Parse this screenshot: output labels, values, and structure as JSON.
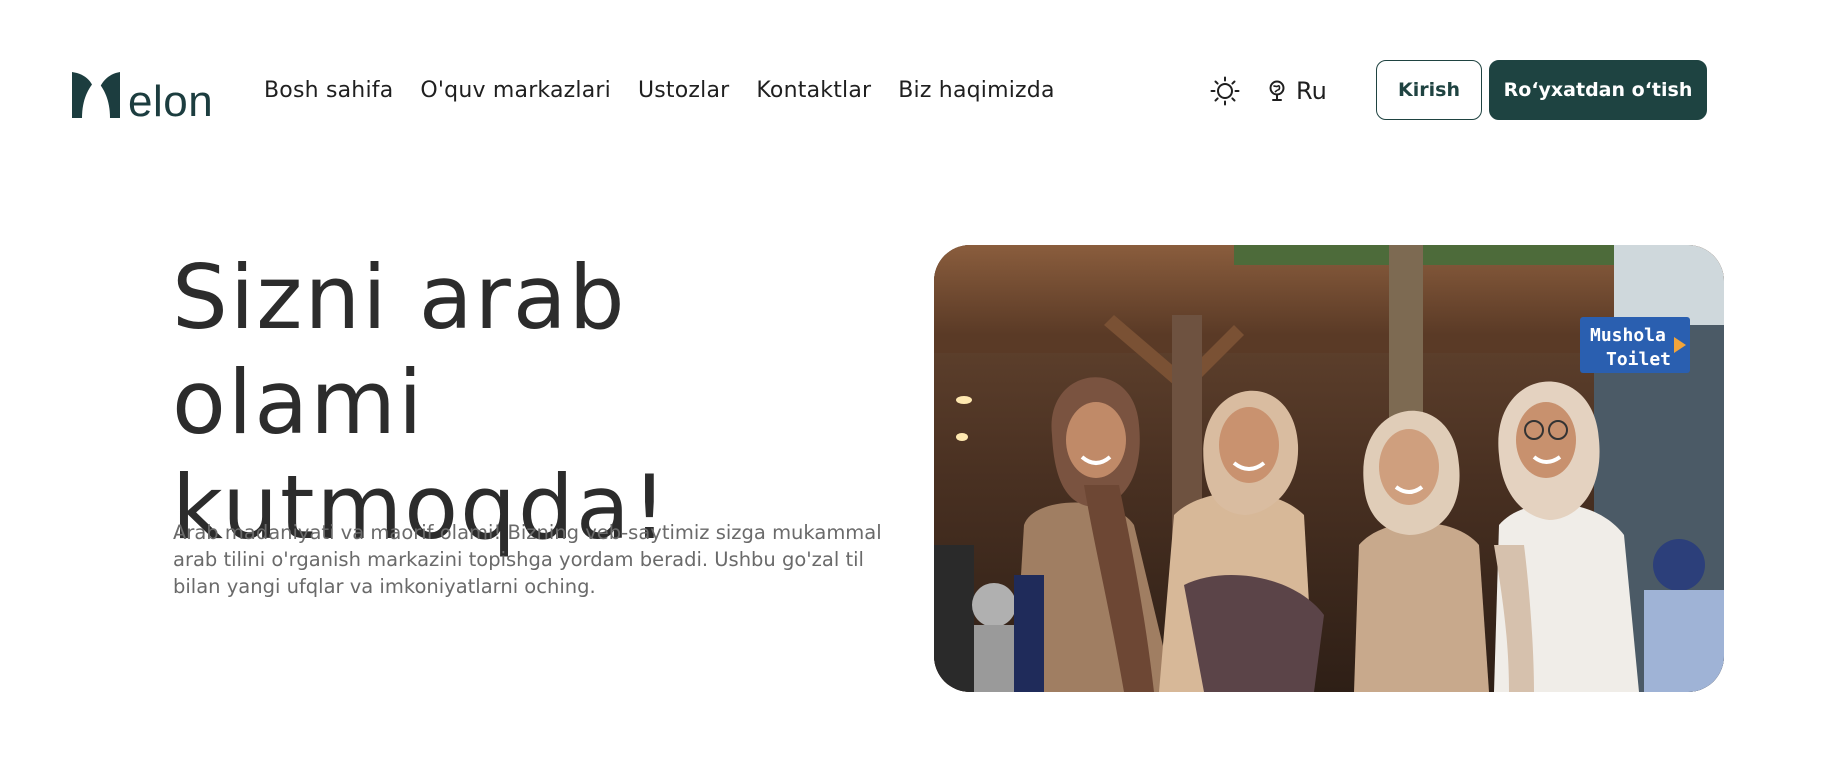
{
  "header": {
    "logo_text": "elon",
    "nav": [
      {
        "label": "Bosh sahifa"
      },
      {
        "label": "O'quv markazlari"
      },
      {
        "label": "Ustozlar"
      },
      {
        "label": "Kontaktlar"
      },
      {
        "label": "Biz haqimizda"
      }
    ],
    "theme_icon": "sun-icon",
    "language_icon": "globe-pin-icon",
    "language": "Ru",
    "login_label": "Kirish",
    "register_label": "Roʻyxatdan oʻtish"
  },
  "hero": {
    "title_line1": "Sizni arab olami",
    "title_line2": "kutmoqda!",
    "description": "Arab madaniyati va maorif olami! Bizning veb-saytimiz sizga mukammal arab tilini o'rganish markazini topishga yordam beradi. Ushbu go'zal til bilan yangi ufqlar va imkoniyatlarni oching.",
    "photo_sign_line1": "Mushola",
    "photo_sign_line2": "Toilet"
  },
  "colors": {
    "brand": "#1e4341",
    "text_dark": "#2c2c2c",
    "text_muted": "#6a6a6a",
    "background": "#ffffff"
  }
}
